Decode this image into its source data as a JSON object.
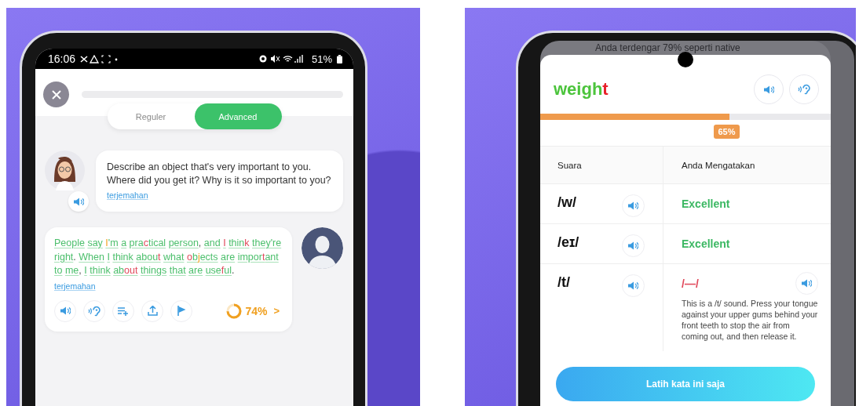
{
  "left_phone": {
    "status_bar": {
      "time": "16:06",
      "battery": "51%"
    },
    "mode_toggle": [
      {
        "label": "Reguler",
        "selected": false
      },
      {
        "label": "Advanced",
        "selected": true
      }
    ],
    "prompt": {
      "text": "Describe an object that's very important to you. Where did you get it? Why is it so important to you?",
      "translate_link": "terjemahan"
    },
    "answer": {
      "words": [
        {
          "parts": [
            {
              "text": "People",
              "kind": "good"
            }
          ]
        },
        {
          "parts": [
            {
              "text": "say",
              "kind": "good"
            }
          ]
        },
        {
          "parts": [
            {
              "text": "I",
              "kind": "fair"
            },
            {
              "text": "'m",
              "kind": "good"
            }
          ]
        },
        {
          "parts": [
            {
              "text": "a",
              "kind": "good"
            }
          ]
        },
        {
          "parts": [
            {
              "text": "pra",
              "kind": "good"
            },
            {
              "text": "c",
              "kind": "bad"
            },
            {
              "text": "tical",
              "kind": "good"
            }
          ]
        },
        {
          "parts": [
            {
              "text": "person",
              "kind": "good"
            }
          ],
          "after": ","
        },
        {
          "parts": [
            {
              "text": "and",
              "kind": "good"
            }
          ]
        },
        {
          "parts": [
            {
              "text": "I",
              "kind": "bad"
            }
          ]
        },
        {
          "parts": [
            {
              "text": "thin",
              "kind": "good"
            },
            {
              "text": "k",
              "kind": "bad"
            }
          ]
        },
        {
          "parts": [
            {
              "text": "they're",
              "kind": "good"
            }
          ]
        },
        {
          "parts": [
            {
              "text": "right",
              "kind": "good"
            }
          ],
          "after": "."
        },
        {
          "parts": [
            {
              "text": "When",
              "kind": "good"
            }
          ]
        },
        {
          "parts": [
            {
              "text": "I",
              "kind": "good"
            }
          ]
        },
        {
          "parts": [
            {
              "text": "think",
              "kind": "good"
            }
          ]
        },
        {
          "parts": [
            {
              "text": "abou",
              "kind": "good"
            },
            {
              "text": "t",
              "kind": "bad"
            }
          ]
        },
        {
          "parts": [
            {
              "text": "what",
              "kind": "good"
            }
          ]
        },
        {
          "parts": [
            {
              "text": "o",
              "kind": "bad"
            },
            {
              "text": "b",
              "kind": "good"
            },
            {
              "text": "j",
              "kind": "fair"
            },
            {
              "text": "ects",
              "kind": "good"
            }
          ]
        },
        {
          "parts": [
            {
              "text": "are",
              "kind": "good"
            }
          ]
        },
        {
          "parts": [
            {
              "text": "impor",
              "kind": "good"
            },
            {
              "text": "t",
              "kind": "bad"
            },
            {
              "text": "ant",
              "kind": "good"
            }
          ]
        },
        {
          "parts": [
            {
              "text": "to",
              "kind": "good"
            }
          ]
        },
        {
          "parts": [
            {
              "text": "me",
              "kind": "good"
            }
          ],
          "after": ","
        },
        {
          "parts": [
            {
              "text": "I",
              "kind": "good"
            }
          ]
        },
        {
          "parts": [
            {
              "text": "think",
              "kind": "good"
            }
          ]
        },
        {
          "parts": [
            {
              "text": "ab",
              "kind": "good"
            },
            {
              "text": "out",
              "kind": "bad"
            }
          ]
        },
        {
          "parts": [
            {
              "text": "things",
              "kind": "good"
            }
          ]
        },
        {
          "parts": [
            {
              "text": "that",
              "kind": "good"
            }
          ]
        },
        {
          "parts": [
            {
              "text": "are",
              "kind": "good"
            }
          ]
        },
        {
          "parts": [
            {
              "text": "use",
              "kind": "good"
            },
            {
              "text": "f",
              "kind": "bad"
            },
            {
              "text": "ul",
              "kind": "good"
            }
          ],
          "after": "."
        }
      ],
      "translate_link": "terjemahan",
      "score": {
        "label": "74%",
        "level": 0.74,
        "chevron": ">"
      }
    }
  },
  "right_phone": {
    "banner": "Anda terdengar 79% seperti native",
    "word": [
      {
        "text": "weigh",
        "kind": "good"
      },
      {
        "text": "t",
        "kind": "bad"
      }
    ],
    "progress": {
      "level": 0.65,
      "label": "65%"
    },
    "table": {
      "columns": [
        "Suara",
        "Anda Mengatakan"
      ],
      "rows": [
        {
          "kind": "good",
          "sound": "/w/",
          "result": "Excellent"
        },
        {
          "kind": "good",
          "sound": "/eɪ/",
          "result": "Excellent"
        },
        {
          "kind": "missed",
          "sound": "/t/",
          "result": "/—/",
          "tip": "This is a /t/ sound. Press your tongue against your upper gums behind your front teeth to stop the air from coming out, and then release it."
        }
      ]
    },
    "button": "Latih kata ini saja"
  }
}
